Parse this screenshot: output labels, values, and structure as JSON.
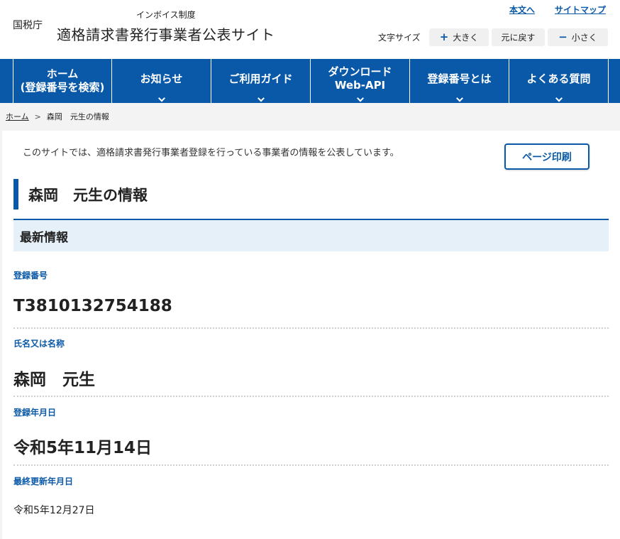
{
  "header": {
    "agency": "国税庁",
    "subtitle": "インボイス制度",
    "title": "適格請求書発行事業者公表サイト",
    "links": {
      "main_content": "本文へ",
      "sitemap": "サイトマップ"
    },
    "font_size": {
      "label": "文字サイズ",
      "bigger": "大きく",
      "bigger_icon": "plus-icon",
      "reset": "元に戻す",
      "smaller": "小さく",
      "smaller_icon": "minus-icon"
    }
  },
  "nav": {
    "items": [
      {
        "label": "ホーム\n(登録番号を検索)",
        "has_dropdown": false
      },
      {
        "label": "お知らせ",
        "has_dropdown": true
      },
      {
        "label": "ご利用ガイド",
        "has_dropdown": true
      },
      {
        "label": "ダウンロード\nWeb-API",
        "has_dropdown": true
      },
      {
        "label": "登録番号とは",
        "has_dropdown": true
      },
      {
        "label": "よくある質問",
        "has_dropdown": true
      }
    ]
  },
  "breadcrumb": {
    "home": "ホーム",
    "current": "森岡　元生の情報"
  },
  "main": {
    "intro": "このサイトでは、適格請求書発行事業者登録を行っている事業者の情報を公表しています。",
    "print_button": "ページ印刷",
    "heading": "森岡　元生の情報",
    "section_title": "最新情報",
    "fields": [
      {
        "label": "登録番号",
        "value": "T3810132754188"
      },
      {
        "label": "氏名又は名称",
        "value": "森岡　元生"
      },
      {
        "label": "登録年月日",
        "value": "令和5年11月14日"
      },
      {
        "label": "最終更新年月日",
        "value": "令和5年12月27日"
      }
    ]
  },
  "colors": {
    "primary": "#0a59a8",
    "section_bg": "#e6f0f8",
    "page_bg": "#f3f3f3"
  }
}
